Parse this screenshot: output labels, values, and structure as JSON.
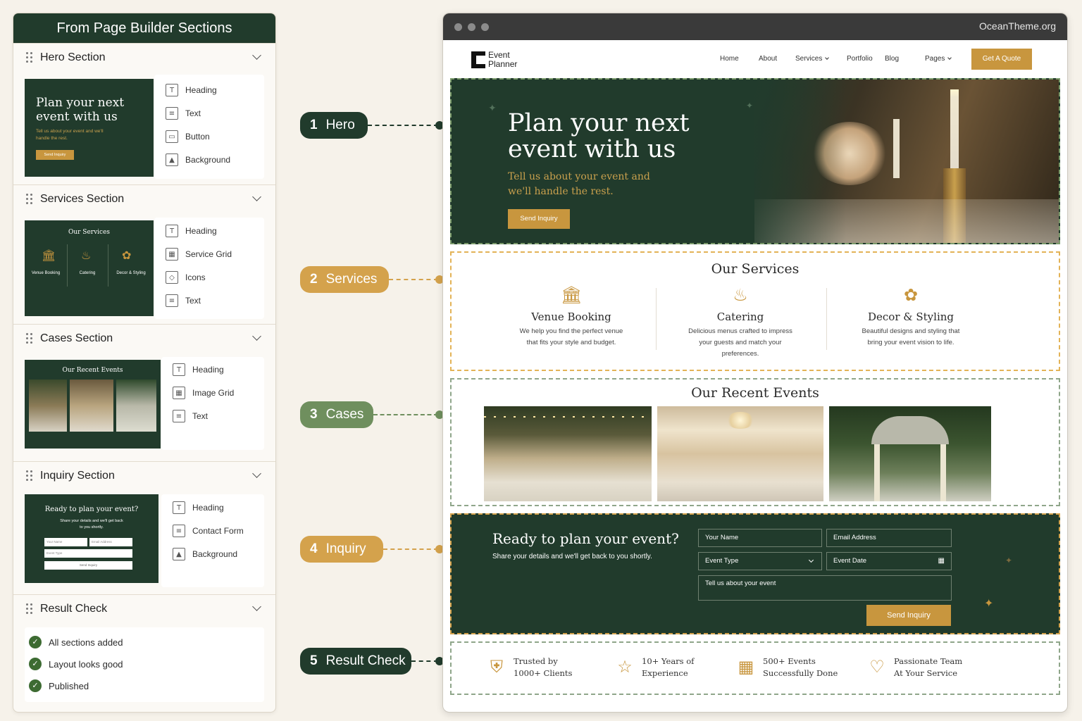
{
  "left_panel": {
    "title": "From Page Builder Sections",
    "sections": [
      {
        "name": "Hero Section",
        "thumb": {
          "title": "Plan your next event with us",
          "subtitle": "Tell us about your event and we'll handle the rest.",
          "button": "Send Inquiry"
        },
        "components": [
          "Heading",
          "Text",
          "Button",
          "Background"
        ]
      },
      {
        "name": "Services Section",
        "thumb": {
          "title": "Our Services",
          "items": [
            "Venue Booking",
            "Catering",
            "Decor & Styling"
          ]
        },
        "components": [
          "Heading",
          "Service Grid",
          "Icons",
          "Text"
        ]
      },
      {
        "name": "Cases Section",
        "thumb": {
          "title": "Our Recent Events"
        },
        "components": [
          "Heading",
          "Image Grid",
          "Text"
        ]
      },
      {
        "name": "Inquiry Section",
        "thumb": {
          "title": "Ready to plan your event?",
          "subtitle": "Share your details and we'll get back to you shortly.",
          "name_field": "Your Name",
          "email_field": "Email Address",
          "event_field": "Event Type",
          "button": "Send Inquiry"
        },
        "components": [
          "Heading",
          "Contact Form",
          "Background"
        ]
      },
      {
        "name": "Result Check",
        "checks": [
          "All sections added",
          "Layout looks good",
          "Published"
        ]
      }
    ]
  },
  "callouts": [
    {
      "num": "1",
      "label": "Hero",
      "color": "#213b2c"
    },
    {
      "num": "2",
      "label": "Services",
      "color": "#d4a24c"
    },
    {
      "num": "3",
      "label": "Cases",
      "color": "#6f8f5e"
    },
    {
      "num": "4",
      "label": "Inquiry",
      "color": "#d4a24c"
    },
    {
      "num": "5",
      "label": "Result Check",
      "color": "#213b2c"
    }
  ],
  "browser": {
    "url": "OceanTheme.org",
    "logo": {
      "line1": "Event",
      "line2": "Planner"
    },
    "nav": [
      "Home",
      "About",
      "Services",
      "Portfolio",
      "Blog",
      "Pages"
    ],
    "cta": "Get A Quote",
    "hero": {
      "title_line1": "Plan your next",
      "title_line2": "event with us",
      "subtitle_line1": "Tell us about your event and",
      "subtitle_line2": "we'll handle the rest.",
      "button": "Send Inquiry"
    },
    "services": {
      "title": "Our Services",
      "items": [
        {
          "name": "Venue Booking",
          "desc": "We help you find the perfect venue that fits your style and budget.",
          "icon": "venue-icon"
        },
        {
          "name": "Catering",
          "desc": "Delicious menus crafted to impress your guests and match your preferences.",
          "icon": "catering-icon"
        },
        {
          "name": "Decor & Styling",
          "desc": "Beautiful designs and styling that bring your event vision to life.",
          "icon": "decor-icon"
        }
      ]
    },
    "cases": {
      "title": "Our Recent Events"
    },
    "inquiry": {
      "title": "Ready to plan your event?",
      "subtitle": "Share your details and we'll get back to you shortly.",
      "name_placeholder": "Your Name",
      "email_placeholder": "Email Address",
      "event_type": "Event Type",
      "event_date": "Event Date",
      "message_placeholder": "Tell us about your event",
      "button": "Send Inquiry"
    },
    "result": [
      {
        "line1": "Trusted by",
        "line2": "1000+ Clients",
        "icon": "shield-check-icon"
      },
      {
        "line1": "10+ Years of",
        "line2": "Experience",
        "icon": "star-icon"
      },
      {
        "line1": "500+ Events",
        "line2": "Successfully Done",
        "icon": "calendar-icon"
      },
      {
        "line1": "Passionate Team",
        "line2": "At Your Service",
        "icon": "heart-icon"
      }
    ]
  },
  "colors": {
    "dark_green": "#213b2c",
    "gold": "#c8963e",
    "sage": "#6f8f5e"
  }
}
